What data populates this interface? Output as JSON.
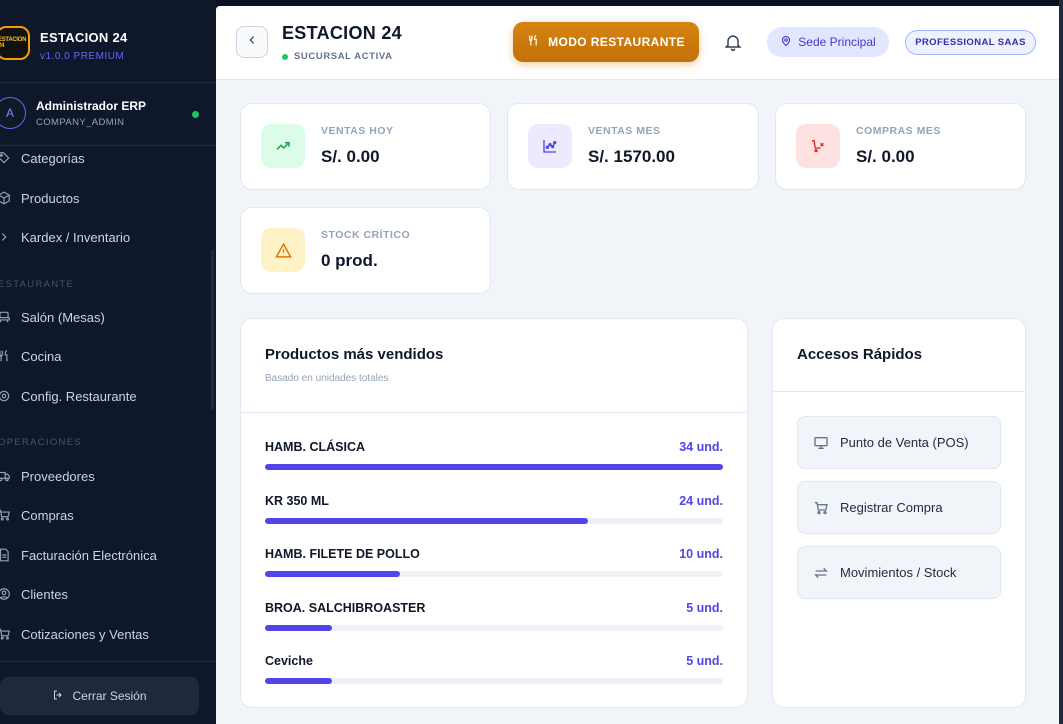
{
  "sidebar": {
    "brand_name": "ESTACION 24",
    "brand_version": "v1.0.0 PREMIUM",
    "logo_text": "ESTACION 24",
    "user_initial": "A",
    "user_name": "Administrador ERP",
    "user_role": "COMPANY_ADMIN",
    "items_top": [
      {
        "label": "Categorías",
        "icon": "tag-icon"
      },
      {
        "label": "Productos",
        "icon": "box-icon"
      },
      {
        "label": "Kardex / Inventario",
        "icon": "chevron-right-icon"
      }
    ],
    "section_restaurant": "ESTAURANTE",
    "items_restaurant": [
      {
        "label": "Salón (Mesas)",
        "icon": "chair-icon"
      },
      {
        "label": "Cocina",
        "icon": "utensils-icon"
      },
      {
        "label": "Config. Restaurante",
        "icon": "gear-icon"
      }
    ],
    "section_operations": "OPERACIONES",
    "items_operations": [
      {
        "label": "Proveedores",
        "icon": "truck-icon"
      },
      {
        "label": "Compras",
        "icon": "cart-icon"
      },
      {
        "label": "Facturación Electrónica",
        "icon": "document-icon"
      },
      {
        "label": "Clientes",
        "icon": "user-icon"
      },
      {
        "label": "Cotizaciones y Ventas",
        "icon": "cart-icon"
      }
    ],
    "logout_label": "Cerrar Sesión"
  },
  "header": {
    "title": "ESTACION 24",
    "branch_status": "SUCURSAL ACTIVA",
    "mode_button": "MODO RESTAURANTE",
    "sede_label": "Sede Principal",
    "plan_badge": "PROFESSIONAL SAAS"
  },
  "stats": [
    {
      "label": "VENTAS HOY",
      "value": "S/. 0.00",
      "icon": "trending-up-icon",
      "bg": "#dcfce7",
      "fg": "#16a34a"
    },
    {
      "label": "VENTAS MES",
      "value": "S/. 1570.00",
      "icon": "chart-nodes-icon",
      "bg": "#ede9fe",
      "fg": "#4f46e5"
    },
    {
      "label": "COMPRAS MES",
      "value": "S/. 0.00",
      "icon": "cart-x-icon",
      "bg": "#fee2e2",
      "fg": "#dc2626"
    },
    {
      "label": "STOCK CRÍTICO",
      "value": "0 prod.",
      "icon": "warning-icon",
      "bg": "#fef3c7",
      "fg": "#d97706"
    }
  ],
  "top_products": {
    "title": "Productos más vendidos",
    "subtitle": "Basado en unidades totales",
    "items": [
      {
        "name": "HAMB. CLÁSICA",
        "qty": "34 und.",
        "units": 34
      },
      {
        "name": "KR 350 ML",
        "qty": "24 und.",
        "units": 24
      },
      {
        "name": "HAMB. FILETE DE POLLO",
        "qty": "10 und.",
        "units": 10
      },
      {
        "name": "BROA. SALCHIBROASTER",
        "qty": "5 und.",
        "units": 5
      },
      {
        "name": "Ceviche",
        "qty": "5 und.",
        "units": 5
      }
    ]
  },
  "quick_access": {
    "title": "Accesos Rápidos",
    "items": [
      {
        "label": "Punto de Venta (POS)",
        "icon": "monitor-icon"
      },
      {
        "label": "Registrar Compra",
        "icon": "cart-icon"
      },
      {
        "label": "Movimientos / Stock",
        "icon": "arrows-swap-icon"
      }
    ]
  },
  "colors": {
    "accent": "#4f46e5",
    "mode_button": "#d97706",
    "sidebar_bg": "#0f172a"
  }
}
